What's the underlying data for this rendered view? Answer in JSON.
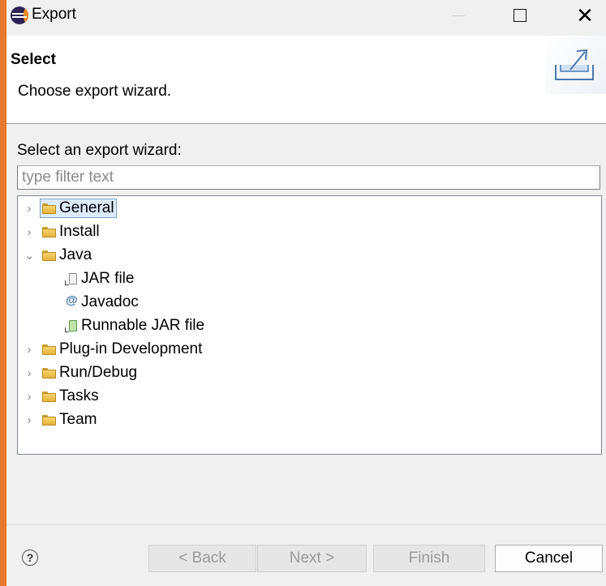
{
  "window": {
    "title": "Export"
  },
  "header": {
    "title": "Select",
    "description": "Choose export wizard."
  },
  "body": {
    "label": "Select an export wizard:",
    "filter_placeholder": "type filter text",
    "tree": [
      {
        "label": "General",
        "type": "folder",
        "expanded": false,
        "selected": true
      },
      {
        "label": "Install",
        "type": "folder",
        "expanded": false
      },
      {
        "label": "Java",
        "type": "folder",
        "expanded": true
      },
      {
        "label": "JAR file",
        "type": "jar",
        "icon": "jar-file-icon"
      },
      {
        "label": "Javadoc",
        "type": "javadoc",
        "icon": "javadoc-icon"
      },
      {
        "label": "Runnable JAR file",
        "type": "runjar",
        "icon": "runnable-jar-icon"
      },
      {
        "label": "Plug-in Development",
        "type": "folder",
        "expanded": false
      },
      {
        "label": "Run/Debug",
        "type": "folder",
        "expanded": false
      },
      {
        "label": "Tasks",
        "type": "folder",
        "expanded": false
      },
      {
        "label": "Team",
        "type": "folder",
        "expanded": false
      }
    ]
  },
  "footer": {
    "help_symbol": "?",
    "back_label": "< Back",
    "next_label": "Next >",
    "finish_label": "Finish",
    "cancel_label": "Cancel"
  },
  "colors": {
    "accent_border": "#e8772f",
    "selection": "#dcebfc"
  }
}
